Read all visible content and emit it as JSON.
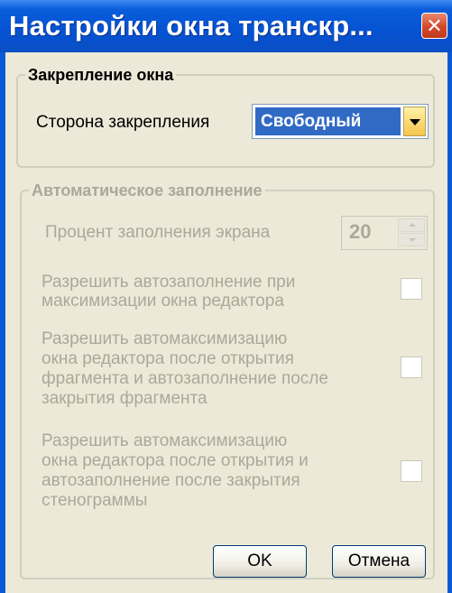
{
  "window": {
    "title": "Настройки окна транскр...",
    "close_glyph": "✕"
  },
  "docking_group": {
    "legend": "Закрепление окна",
    "side_label": "Сторона закрепления",
    "side_value": "Свободный"
  },
  "autofill_group": {
    "legend": "Автоматическое заполнение",
    "percent_label": "Процент заполнения экрана",
    "percent_value": "20",
    "option1_line1": "Разрешить автозаполнение при",
    "option1_line2": "максимизации окна редактора",
    "option1_checked": false,
    "option2_line1": "Разрешить автомаксимизацию",
    "option2_line2": "окна редактора после открытия",
    "option2_line3": "фрагмента и автозаполнение после",
    "option2_line4": "закрытия фрагмента",
    "option2_checked": false,
    "option3_line1": "Разрешить автомаксимизацию",
    "option3_line2": "окна редактора после открытия и",
    "option3_line3": "автозаполнение после закрытия",
    "option3_line4": "стенограммы",
    "option3_checked": false
  },
  "buttons": {
    "ok": "OK",
    "cancel": "Отмена"
  },
  "colors": {
    "titlebar": "#0a5ad8",
    "selection": "#316ac5",
    "disabled_text": "#aca899",
    "dialog_bg": "#ece9d8"
  }
}
